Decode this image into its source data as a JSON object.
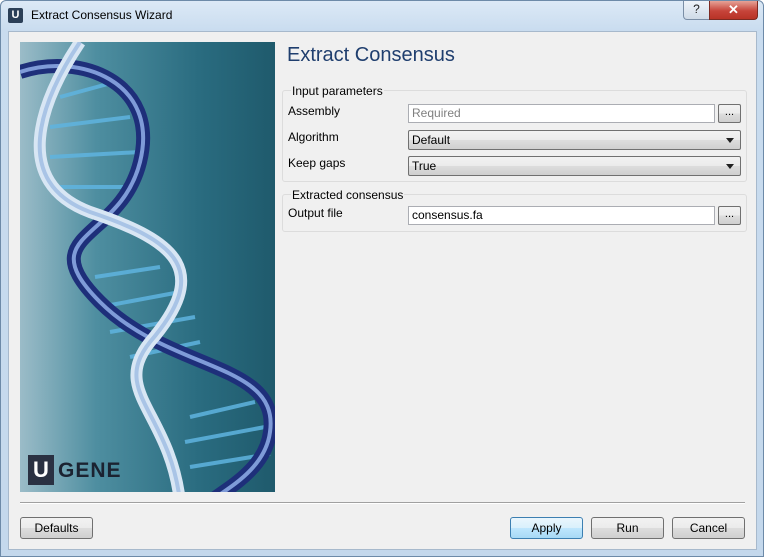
{
  "window": {
    "title": "Extract Consensus Wizard",
    "app_icon_letter": "U",
    "help_glyph": "?",
    "close_glyph": "✕"
  },
  "page": {
    "title": "Extract Consensus"
  },
  "logo": {
    "letter": "U",
    "text": "GENE"
  },
  "input_group": {
    "title": "Input parameters",
    "assembly": {
      "label": "Assembly",
      "placeholder": "Required",
      "browse": "..."
    },
    "algorithm": {
      "label": "Algorithm",
      "value": "Default"
    },
    "keep_gaps": {
      "label": "Keep gaps",
      "value": "True"
    }
  },
  "output_group": {
    "title": "Extracted consensus",
    "output_file": {
      "label": "Output file",
      "value": "consensus.fa",
      "browse": "..."
    }
  },
  "buttons": {
    "defaults": "Defaults",
    "apply": "Apply",
    "run": "Run",
    "cancel": "Cancel"
  },
  "colors": {
    "title_blue": "#1f3e6e",
    "close_red": "#c6443a",
    "default_button": "#bee6fd"
  },
  "icons": {
    "dna_image": "dna-helix-image",
    "dropdown": "chevron-down-icon"
  }
}
